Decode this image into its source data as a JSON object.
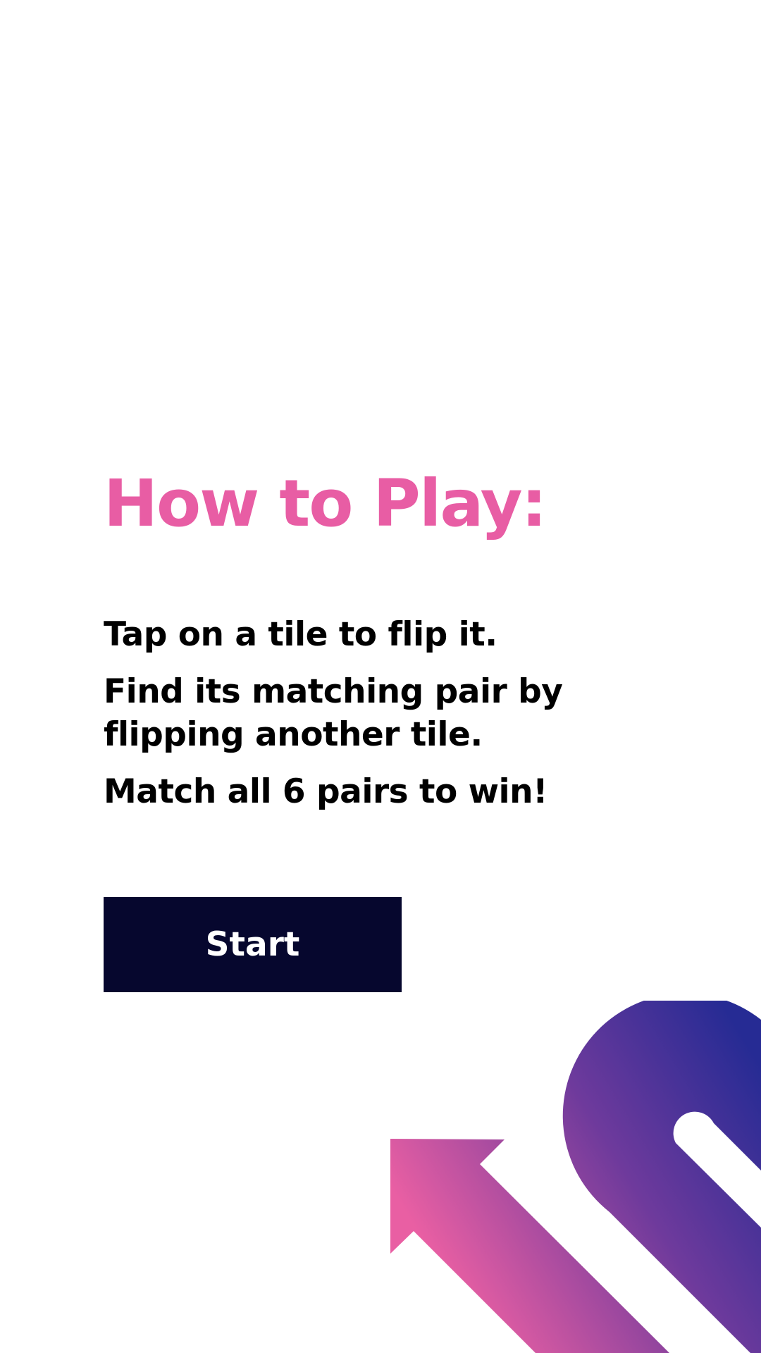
{
  "app": {
    "background_color": "#ffffff",
    "accent_color": "#e85da4",
    "text_color": "#000000",
    "button_color": "#06072e",
    "button_text_color": "#ffffff"
  },
  "how_to_play": {
    "title": "How to Play:",
    "instructions": [
      "Tap on a tile to flip it.",
      "Find its matching pair by flipping another tile.",
      "Match all 6 pairs to win!"
    ],
    "start_label": "Start"
  },
  "decoration": {
    "icon": "brand-arrow-graphic",
    "gradient_start": "#e95fa3",
    "gradient_mid": "#6e3a9c",
    "gradient_end": "#262b94"
  }
}
